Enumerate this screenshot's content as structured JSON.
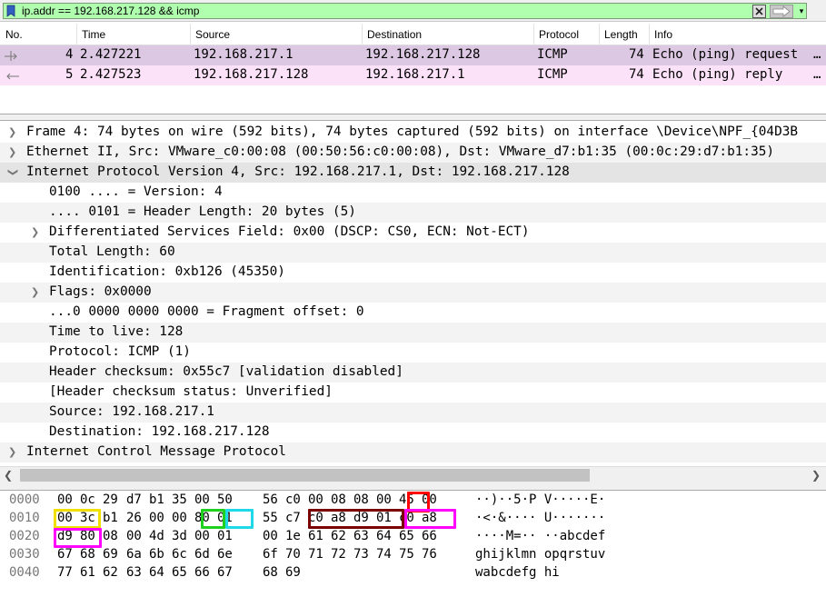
{
  "filter": {
    "text": "ip.addr == 192.168.217.128 && icmp",
    "bg_color": "#afffaf"
  },
  "packet_list": {
    "columns": [
      "No.",
      "Time",
      "Source",
      "Destination",
      "Protocol",
      "Length",
      "Info"
    ],
    "rows": [
      {
        "no": "4",
        "time": "2.427221",
        "source": "192.168.217.1",
        "destination": "192.168.217.128",
        "protocol": "ICMP",
        "length": "74",
        "info": "Echo (ping) request",
        "ellipsis": "…",
        "color": "#dcc8e2"
      },
      {
        "no": "5",
        "time": "2.427523",
        "source": "192.168.217.128",
        "destination": "192.168.217.1",
        "protocol": "ICMP",
        "length": "74",
        "info": "Echo (ping) reply",
        "ellipsis": "…",
        "color": "#fbe2f8"
      }
    ]
  },
  "details": {
    "frame": "Frame 4: 74 bytes on wire (592 bits), 74 bytes captured (592 bits) on interface \\Device\\NPF_{04D3B",
    "ethernet": "Ethernet II, Src: VMware_c0:00:08 (00:50:56:c0:00:08), Dst: VMware_d7:b1:35 (00:0c:29:d7:b1:35)",
    "ip": "Internet Protocol Version 4, Src: 192.168.217.1, Dst: 192.168.217.128",
    "ip_fields": {
      "version": "0100 .... = Version: 4",
      "header_length": ".... 0101 = Header Length: 20 bytes (5)",
      "dsf": "Differentiated Services Field: 0x00 (DSCP: CS0, ECN: Not-ECT)",
      "total_length": "Total Length: 60",
      "identification": "Identification: 0xb126 (45350)",
      "flags": "Flags: 0x0000",
      "fragment_offset": "...0 0000 0000 0000 = Fragment offset: 0",
      "ttl": "Time to live: 128",
      "protocol": "Protocol: ICMP (1)",
      "checksum": "Header checksum: 0x55c7 [validation disabled]",
      "checksum_status": "[Header checksum status: Unverified]",
      "source": "Source: 192.168.217.1",
      "destination": "Destination: 192.168.217.128"
    },
    "icmp": "Internet Control Message Protocol"
  },
  "hex": {
    "rows": [
      {
        "offset": "0000",
        "bytes": [
          "00",
          "0c",
          "29",
          "d7",
          "b1",
          "35",
          "00",
          "50",
          "56",
          "c0",
          "00",
          "08",
          "08",
          "00",
          "45",
          "00"
        ],
        "ascii": "··)··5·P V·····E·"
      },
      {
        "offset": "0010",
        "bytes": [
          "00",
          "3c",
          "b1",
          "26",
          "00",
          "00",
          "80",
          "01",
          "55",
          "c7",
          "c0",
          "a8",
          "d9",
          "01",
          "c0",
          "a8"
        ],
        "ascii": "·<·&···· U·······"
      },
      {
        "offset": "0020",
        "bytes": [
          "d9",
          "80",
          "08",
          "00",
          "4d",
          "3d",
          "00",
          "01",
          "00",
          "1e",
          "61",
          "62",
          "63",
          "64",
          "65",
          "66"
        ],
        "ascii": "····M=·· ··abcdef"
      },
      {
        "offset": "0030",
        "bytes": [
          "67",
          "68",
          "69",
          "6a",
          "6b",
          "6c",
          "6d",
          "6e",
          "6f",
          "70",
          "71",
          "72",
          "73",
          "74",
          "75",
          "76"
        ],
        "ascii": "ghijklmn opqrstuv"
      },
      {
        "offset": "0040",
        "bytes": [
          "77",
          "61",
          "62",
          "63",
          "64",
          "65",
          "66",
          "67",
          "68",
          "69"
        ],
        "ascii": "wabcdefg hi"
      }
    ],
    "highlight_colors": {
      "version_ihl": "#ff0000",
      "total_length": "#f0e000",
      "ttl": "#20d020",
      "protocol": "#20d8e8",
      "source_ip": "#7a0000",
      "destination_ip": "#ff00ff"
    }
  }
}
